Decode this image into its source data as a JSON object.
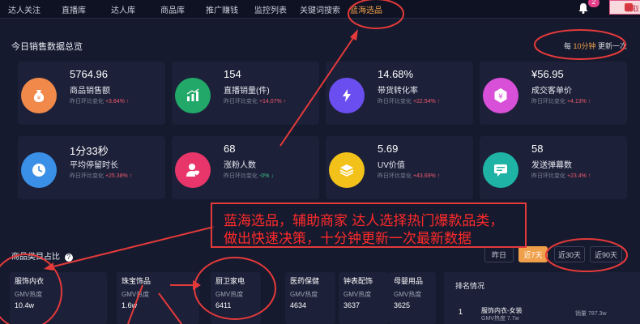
{
  "nav": {
    "items": [
      "达人关注",
      "直播库",
      "达人库",
      "商品库",
      "推广赚钱",
      "监控列表",
      "关键词搜索",
      "蓝海选品"
    ],
    "notification_count": "2",
    "vip_label": "领取"
  },
  "overview": {
    "title": "今日销售数据总览",
    "freq_prefix": "每 ",
    "freq_value": "10分钟",
    "freq_suffix": " 更新一次"
  },
  "metrics": [
    {
      "value": "5764.96",
      "label": "商品销售额",
      "cmp_label": "昨日环比变化",
      "change": "+3.84%",
      "trend": "up",
      "color": "#f0894a",
      "icon": "money-bag-icon"
    },
    {
      "value": "154",
      "label": "直播销量(件)",
      "cmp_label": "昨日环比变化",
      "change": "+14.07%",
      "trend": "up",
      "color": "#22a869",
      "icon": "bar-chart-icon"
    },
    {
      "value": "14.68%",
      "label": "带货转化率",
      "cmp_label": "昨日环比变化",
      "change": "+22.54%",
      "trend": "up",
      "color": "#6a4ef0",
      "icon": "lightning-icon"
    },
    {
      "value": "¥56.95",
      "label": "成交客单价",
      "cmp_label": "昨日环比变化",
      "change": "+4.13%",
      "trend": "up",
      "color": "#d84fd8",
      "icon": "yen-icon"
    },
    {
      "value": "1分33秒",
      "label": "平均停留时长",
      "cmp_label": "昨日环比变化",
      "change": "+25.38%",
      "trend": "up",
      "color": "#3a8fe6",
      "icon": "clock-icon"
    },
    {
      "value": "68",
      "label": "涨粉人数",
      "cmp_label": "昨日环比变化",
      "change": "-0%",
      "trend": "flat",
      "color": "#e8356a",
      "icon": "user-heart-icon"
    },
    {
      "value": "5.69",
      "label": "UV价值",
      "cmp_label": "昨日环比变化",
      "change": "+43.69%",
      "trend": "up",
      "color": "#f2c21a",
      "icon": "layers-icon"
    },
    {
      "value": "58",
      "label": "发送弹幕数",
      "cmp_label": "昨日环比变化",
      "change": "+23.4%",
      "trend": "up",
      "color": "#1fb3a5",
      "icon": "chat-icon"
    }
  ],
  "annotation": {
    "line1": "蓝海选品，辅助商家 达人选择热门爆款品类，",
    "line2": "做出快速决策，十分钟更新一次最新数据"
  },
  "categories": {
    "title": "商品类目占比",
    "tabs": [
      "昨日",
      "近7天",
      "近30天",
      "近90天"
    ],
    "active_tab": "近7天",
    "gmv_label": "GMV热度",
    "items": [
      {
        "name": "服饰内衣",
        "value": "10.4w"
      },
      {
        "name": "珠宝饰品",
        "value": "1.6w"
      },
      {
        "name": "厨卫家电",
        "value": "6411"
      },
      {
        "name": "医药保健",
        "value": "4634"
      },
      {
        "name": "钟表配饰",
        "value": "3637"
      },
      {
        "name": "母婴用品",
        "value": "3625"
      }
    ]
  },
  "ranking": {
    "title": "排名情况",
    "rows": [
      {
        "rank": "1",
        "name": "服饰内衣-女装",
        "gmv": "GMV热度 7.7w",
        "sales": "销量 787.3w"
      }
    ]
  }
}
